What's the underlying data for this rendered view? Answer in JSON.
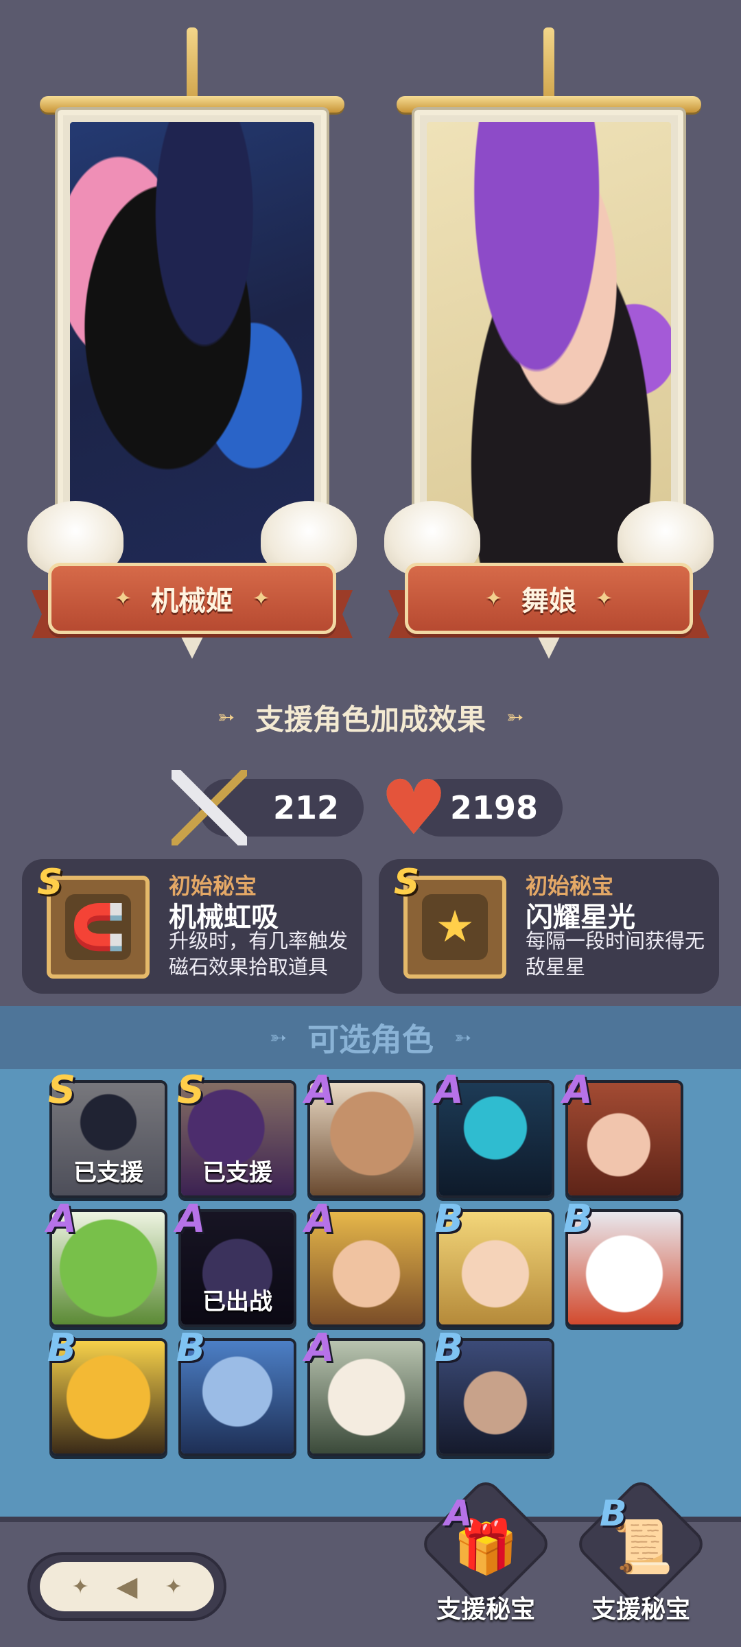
{
  "banners": [
    {
      "name": "机械姬",
      "art": "mech-girl-portrait"
    },
    {
      "name": "舞娘",
      "art": "dancer-portrait"
    }
  ],
  "section_title": "支援角色加成效果",
  "stats": {
    "attack": {
      "icon": "sword-icon",
      "value": "212"
    },
    "health": {
      "icon": "heart-icon",
      "value": "2198"
    }
  },
  "treasures": [
    {
      "rank": "S",
      "label": "初始秘宝",
      "name": "机械虹吸",
      "desc": "升级时，有几率触发磁石效果拾取道具",
      "icon": "magnet-spring-icon"
    },
    {
      "rank": "S",
      "label": "初始秘宝",
      "name": "闪耀星光",
      "desc": "每隔一段时间获得无敌星星",
      "icon": "star-icon"
    }
  ],
  "select_header": "可选角色",
  "characters": [
    {
      "rank": "S",
      "status": "已支援"
    },
    {
      "rank": "S",
      "status": "已支援"
    },
    {
      "rank": "A",
      "status": ""
    },
    {
      "rank": "A",
      "status": ""
    },
    {
      "rank": "A",
      "status": ""
    },
    {
      "rank": "A",
      "status": ""
    },
    {
      "rank": "A",
      "status": "已出战"
    },
    {
      "rank": "A",
      "status": ""
    },
    {
      "rank": "B",
      "status": ""
    },
    {
      "rank": "B",
      "status": ""
    },
    {
      "rank": "B",
      "status": ""
    },
    {
      "rank": "B",
      "status": ""
    },
    {
      "rank": "A",
      "status": ""
    },
    {
      "rank": "B",
      "status": ""
    }
  ],
  "bottom": {
    "back_icon": "back-arrow-icon",
    "support_buttons": [
      {
        "rank": "A",
        "label": "支援秘宝",
        "icon": "gift-box-icon"
      },
      {
        "rank": "B",
        "label": "支援秘宝",
        "icon": "scroll-icon"
      }
    ]
  },
  "colors": {
    "background": "#5b5a6e",
    "ribbon": "#c45a3c",
    "select_area": "#5b95bb",
    "rank_S": "#ffcf4a",
    "rank_A": "#b672e8",
    "rank_B": "#7fc3f2"
  }
}
